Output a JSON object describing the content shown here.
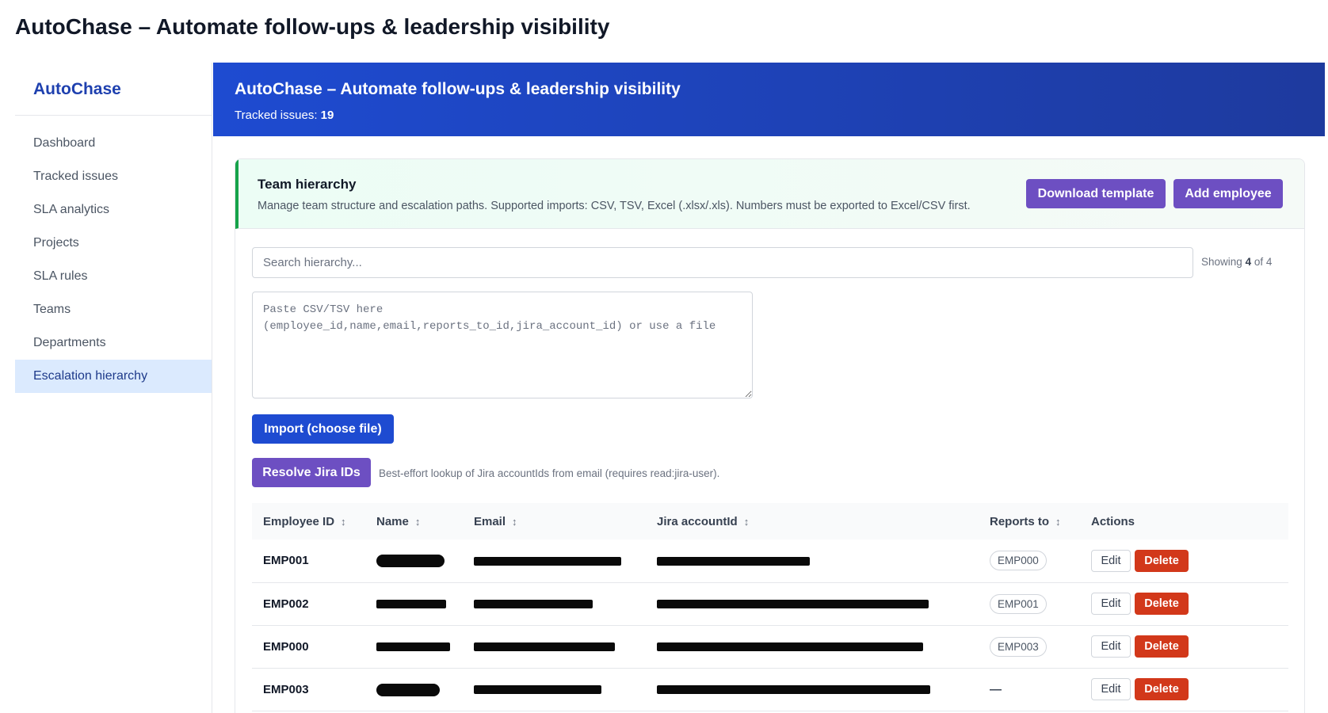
{
  "page": {
    "title": "AutoChase – Automate follow-ups & leadership visibility"
  },
  "sidebar": {
    "brand": "AutoChase",
    "items": [
      {
        "label": "Dashboard"
      },
      {
        "label": "Tracked issues"
      },
      {
        "label": "SLA analytics"
      },
      {
        "label": "Projects"
      },
      {
        "label": "SLA rules"
      },
      {
        "label": "Teams"
      },
      {
        "label": "Departments"
      },
      {
        "label": "Escalation hierarchy",
        "active": true
      }
    ]
  },
  "header": {
    "title": "AutoChase – Automate follow-ups & leadership visibility",
    "tracked_label": "Tracked issues:",
    "tracked_count": "19"
  },
  "card": {
    "title": "Team hierarchy",
    "description": "Manage team structure and escalation paths. Supported imports: CSV, TSV, Excel (.xlsx/.xls). Numbers must be exported to Excel/CSV first.",
    "download_label": "Download template",
    "add_label": "Add employee",
    "search_placeholder": "Search hierarchy...",
    "showing_prefix": "Showing",
    "showing_count": "4",
    "showing_suffix": "of 4",
    "paste_placeholder": "Paste CSV/TSV here (employee_id,name,email,reports_to_id,jira_account_id) or use a file",
    "import_label": "Import (choose file)",
    "resolve_label": "Resolve Jira IDs",
    "resolve_note": "Best-effort lookup of Jira accountIds from email (requires read:jira-user)."
  },
  "table": {
    "columns": [
      {
        "label": "Employee ID",
        "sortable": true
      },
      {
        "label": "Name",
        "sortable": true
      },
      {
        "label": "Email",
        "sortable": true
      },
      {
        "label": "Jira accountId",
        "sortable": true
      },
      {
        "label": "Reports to",
        "sortable": true
      },
      {
        "label": "Actions",
        "sortable": false
      }
    ],
    "sort_icon": "↕",
    "edit_label": "Edit",
    "delete_label": "Delete",
    "rows": [
      {
        "employee_id": "EMP001",
        "reports_to": "EMP000"
      },
      {
        "employee_id": "EMP002",
        "reports_to": "EMP001"
      },
      {
        "employee_id": "EMP000",
        "reports_to": "EMP003"
      },
      {
        "employee_id": "EMP003",
        "reports_to": "—"
      }
    ]
  },
  "colors": {
    "header_blue": "#1e4bd1",
    "primary_purple": "#6d4fc2",
    "danger_red": "#d2381a",
    "accent_green": "#16a34a",
    "active_nav_bg": "#dbeafe"
  }
}
